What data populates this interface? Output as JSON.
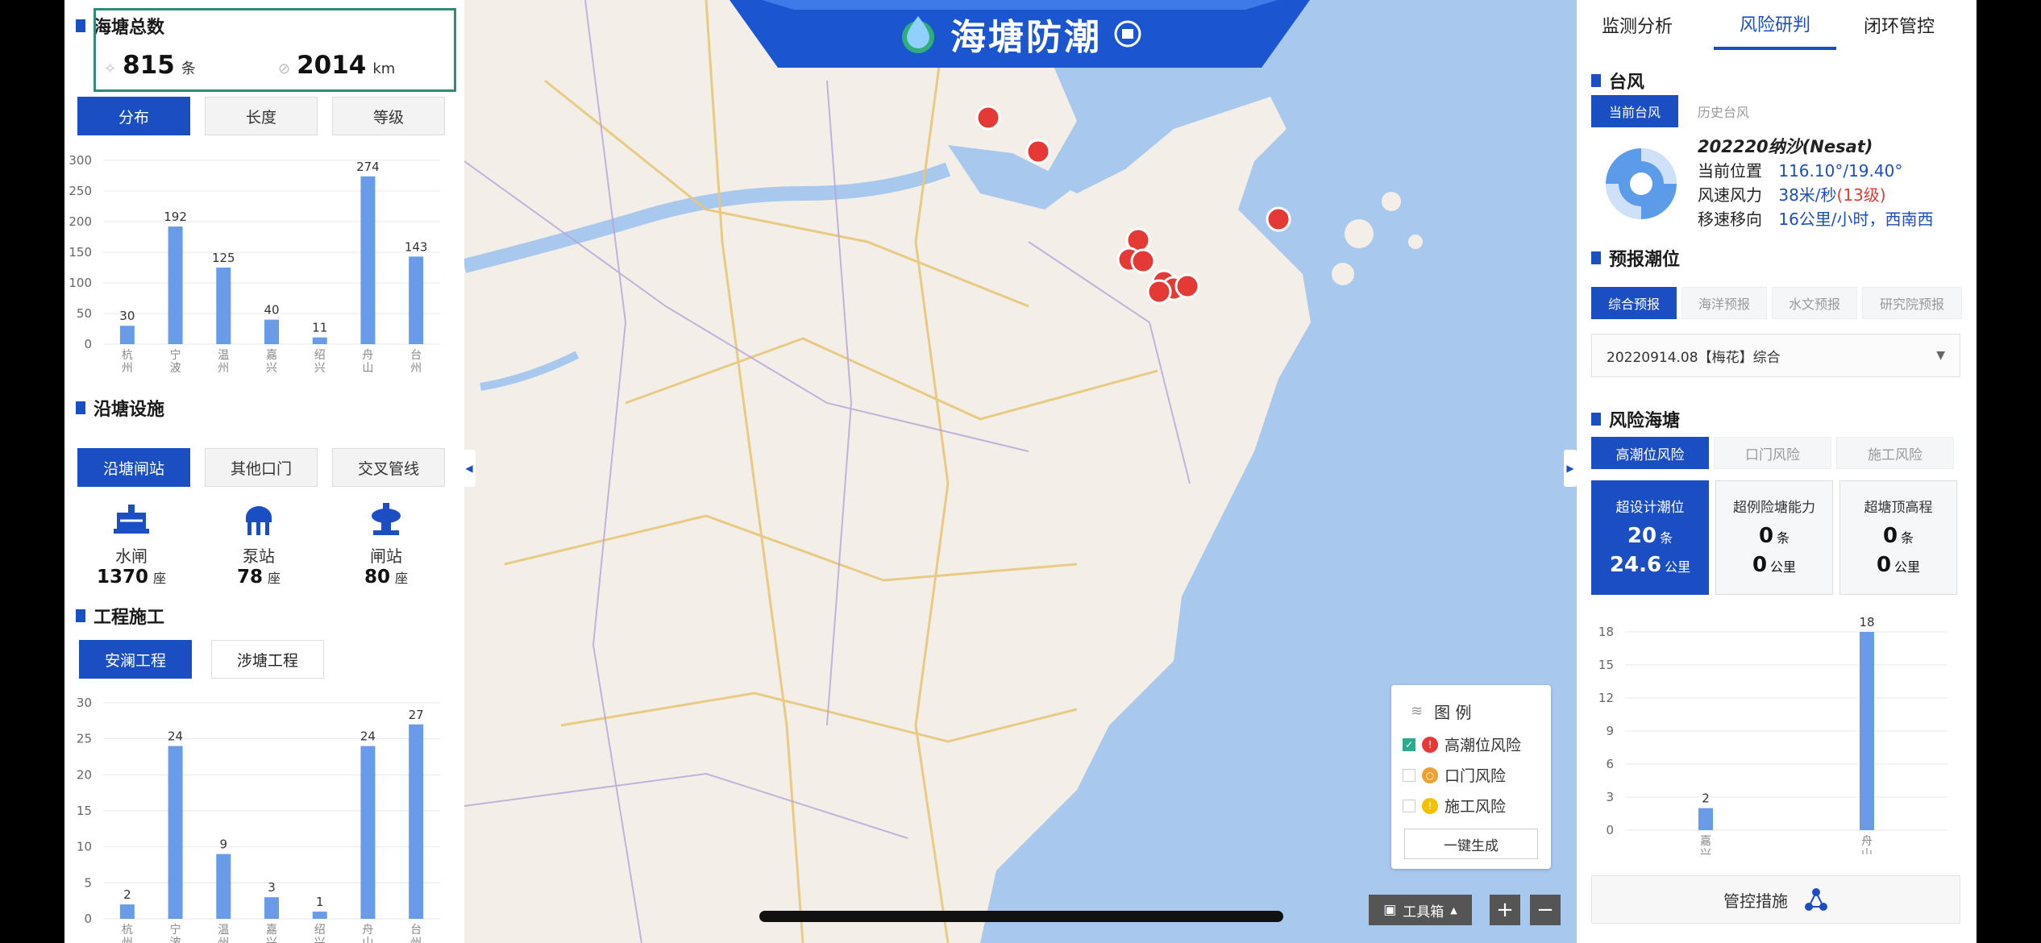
{
  "header": {
    "title": "海塘防潮"
  },
  "left": {
    "seawall_total": {
      "title": "海塘总数",
      "count": "815",
      "count_unit": "条",
      "length": "2014",
      "length_unit": "km"
    },
    "distribution_tabs": [
      "分布",
      "长度",
      "等级"
    ],
    "distribution_chart": {
      "type": "bar",
      "categories": [
        "杭州",
        "宁波",
        "温州",
        "嘉兴",
        "绍兴",
        "舟山",
        "台州"
      ],
      "values": [
        30,
        192,
        125,
        40,
        11,
        274,
        143
      ],
      "ylim": [
        0,
        300
      ],
      "yticks": [
        0,
        50,
        100,
        150,
        200,
        250,
        300
      ]
    },
    "facilities": {
      "title": "沿塘设施",
      "tabs": [
        "沿塘闸站",
        "其他口门",
        "交叉管线"
      ],
      "items": [
        {
          "label": "水闸",
          "value": "1370",
          "unit": "座",
          "icon": "sluice-icon"
        },
        {
          "label": "泵站",
          "value": "78",
          "unit": "座",
          "icon": "pump-station-icon"
        },
        {
          "label": "闸站",
          "value": "80",
          "unit": "座",
          "icon": "gate-station-icon"
        }
      ]
    },
    "construction": {
      "title": "工程施工",
      "tabs": [
        "安澜工程",
        "涉塘工程"
      ],
      "chart": {
        "type": "bar",
        "categories": [
          "杭州",
          "宁波",
          "温州",
          "嘉兴",
          "绍兴",
          "舟山",
          "台州"
        ],
        "values": [
          2,
          24,
          9,
          3,
          1,
          24,
          27
        ],
        "ylim": [
          0,
          30
        ],
        "yticks": [
          0,
          5,
          10,
          15,
          20,
          25,
          30
        ]
      }
    }
  },
  "right": {
    "tabs": [
      "监测分析",
      "风险研判",
      "闭环管控"
    ],
    "typhoon": {
      "title": "台风",
      "tabs": [
        "当前台风",
        "历史台风"
      ],
      "name": "202220纳沙(Nesat)",
      "position_label": "当前位置",
      "position_value": "116.10°/19.40°",
      "wind_label": "风速风力",
      "wind_value": "38米/秒",
      "wind_level": "(13级)",
      "move_label": "移速移向",
      "move_value": "16公里/小时，西南西"
    },
    "forecast": {
      "title": "预报潮位",
      "tabs": [
        "综合预报",
        "海洋预报",
        "水文预报",
        "研究院预报"
      ],
      "selected": "20220914.08【梅花】综合"
    },
    "risk": {
      "title": "风险海塘",
      "tabs": [
        "高潮位风险",
        "口门风险",
        "施工风险"
      ],
      "cards": [
        {
          "title": "超设计潮位",
          "count": "20",
          "count_unit": "条",
          "length": "24.6",
          "length_unit": "公里"
        },
        {
          "title": "超例险塘能力",
          "count": "0",
          "count_unit": "条",
          "length": "0",
          "length_unit": "公里"
        },
        {
          "title": "超塘顶高程",
          "count": "0",
          "count_unit": "条",
          "length": "0",
          "length_unit": "公里"
        }
      ],
      "chart": {
        "type": "bar",
        "categories": [
          "嘉兴",
          "舟山"
        ],
        "values": [
          2,
          18
        ],
        "ylim": [
          0,
          18
        ],
        "yticks": [
          0,
          3,
          6,
          9,
          12,
          15,
          18
        ]
      },
      "action": "管控措施"
    }
  },
  "legend": {
    "title": "图 例",
    "items": [
      {
        "label": "高潮位风险",
        "checked": true,
        "color": "#e53935"
      },
      {
        "label": "口门风险",
        "checked": false,
        "color": "#f0a030"
      },
      {
        "label": "施工风险",
        "checked": false,
        "color": "#f5c000"
      }
    ],
    "generate": "一键生成"
  },
  "toolbar": {
    "toolbox": "工具箱",
    "zoom_in": "+",
    "zoom_out": "−"
  },
  "colors": {
    "primary": "#1b4ec3",
    "bar": "#6a9be8",
    "risk": "#e53935"
  }
}
